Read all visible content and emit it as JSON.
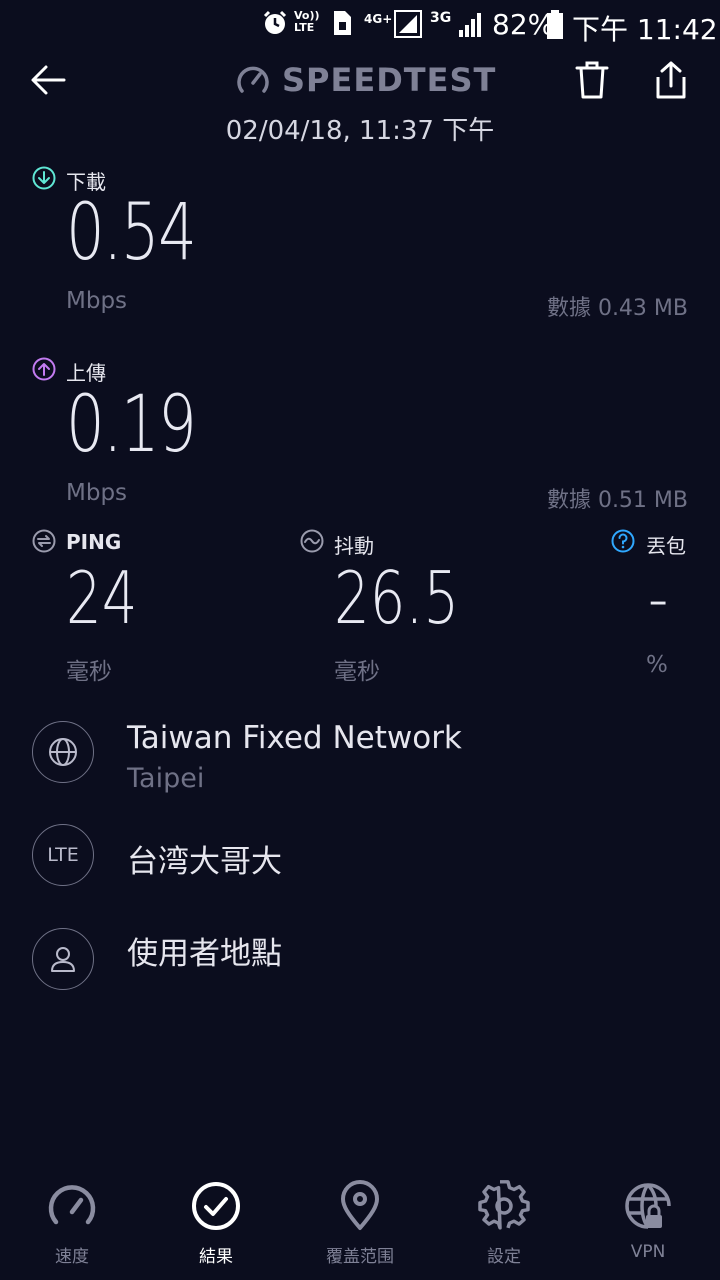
{
  "status_bar": {
    "network_tag_1": "Vo)) LTE",
    "network_tag_2": "4G+",
    "network_tag_3": "3G",
    "battery": "82%",
    "time": "下午 11:42"
  },
  "header": {
    "logo_text": "SPEEDTEST",
    "test_date": "02/04/18, 11:37 下午"
  },
  "download": {
    "label": "下載",
    "value": "0.54",
    "unit": "Mbps",
    "data_amount": "數據 0.43 MB"
  },
  "upload": {
    "label": "上傳",
    "value": "0.19",
    "unit": "Mbps",
    "data_amount": "數據 0.51 MB"
  },
  "ping": {
    "label": "PING",
    "value": "24",
    "unit": "毫秒"
  },
  "jitter": {
    "label": "抖動",
    "value": "26.5",
    "unit": "毫秒"
  },
  "packet_loss": {
    "label": "丟包",
    "value": "-",
    "unit": "%"
  },
  "server": {
    "name": "Taiwan Fixed Network",
    "location": "Taipei"
  },
  "carrier": {
    "icon_label": "LTE",
    "name": "台湾大哥大"
  },
  "user_location": {
    "name": "使用者地點"
  },
  "bottom_nav": {
    "speed": "速度",
    "results": "結果",
    "coverage": "覆盖范围",
    "settings": "設定",
    "vpn": "VPN"
  },
  "colors": {
    "background": "#0b0d1e",
    "download_accent": "#5fe6d4",
    "upload_accent": "#c27bf0",
    "help_accent": "#2fa8ff",
    "muted": "#6f7186"
  }
}
